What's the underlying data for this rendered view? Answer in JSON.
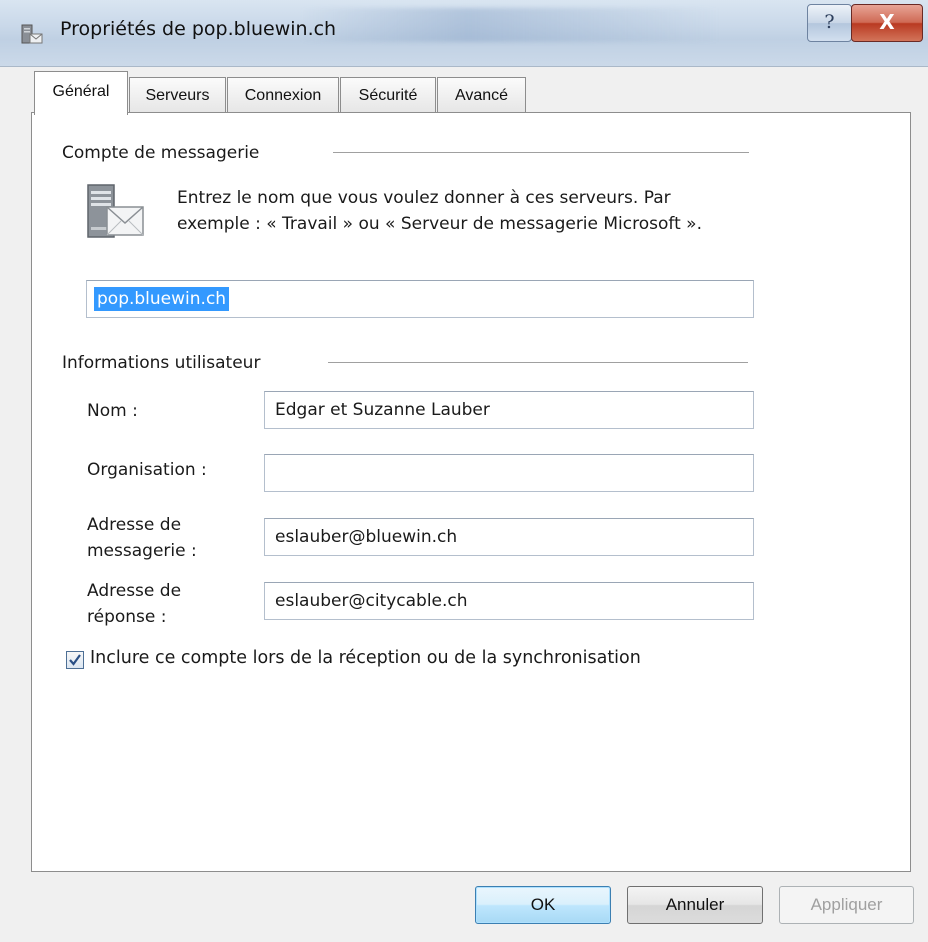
{
  "window": {
    "title": "Propriétés de pop.bluewin.ch",
    "help_glyph": "?",
    "close_glyph": "X"
  },
  "tabs": [
    {
      "label": "Général",
      "active": true
    },
    {
      "label": "Serveurs",
      "active": false
    },
    {
      "label": "Connexion",
      "active": false
    },
    {
      "label": "Sécurité",
      "active": false
    },
    {
      "label": "Avancé",
      "active": false
    }
  ],
  "account_group": {
    "title": "Compte de messagerie",
    "description_line1": "Entrez le nom que vous voulez donner à ces serveurs. Par",
    "description_line2": "exemple : « Travail » ou « Serveur de messagerie Microsoft ».",
    "account_name": "pop.bluewin.ch"
  },
  "user_group": {
    "title": "Informations utilisateur",
    "name_label": "Nom :",
    "name_value": "Edgar et Suzanne Lauber",
    "org_label": "Organisation :",
    "org_value": "",
    "email_label_line1": "Adresse de",
    "email_label_line2": "messagerie :",
    "email_value": "eslauber@bluewin.ch",
    "reply_label_line1": "Adresse de",
    "reply_label_line2": "réponse :",
    "reply_value": "eslauber@citycable.ch"
  },
  "include_checkbox": {
    "label": "Inclure ce compte lors de la réception ou de la synchronisation",
    "checked": true
  },
  "buttons": {
    "ok": "OK",
    "cancel": "Annuler",
    "apply": "Appliquer"
  },
  "colors": {
    "selection": "#3399ff",
    "panel_bg": "#ffffff",
    "dialog_bg": "#f0f0f0",
    "close_button": "#c9452d"
  },
  "icons": {
    "title_icon": "mail-server-icon",
    "account_icon": "mail-server-icon",
    "check_icon": "checkmark-icon"
  }
}
